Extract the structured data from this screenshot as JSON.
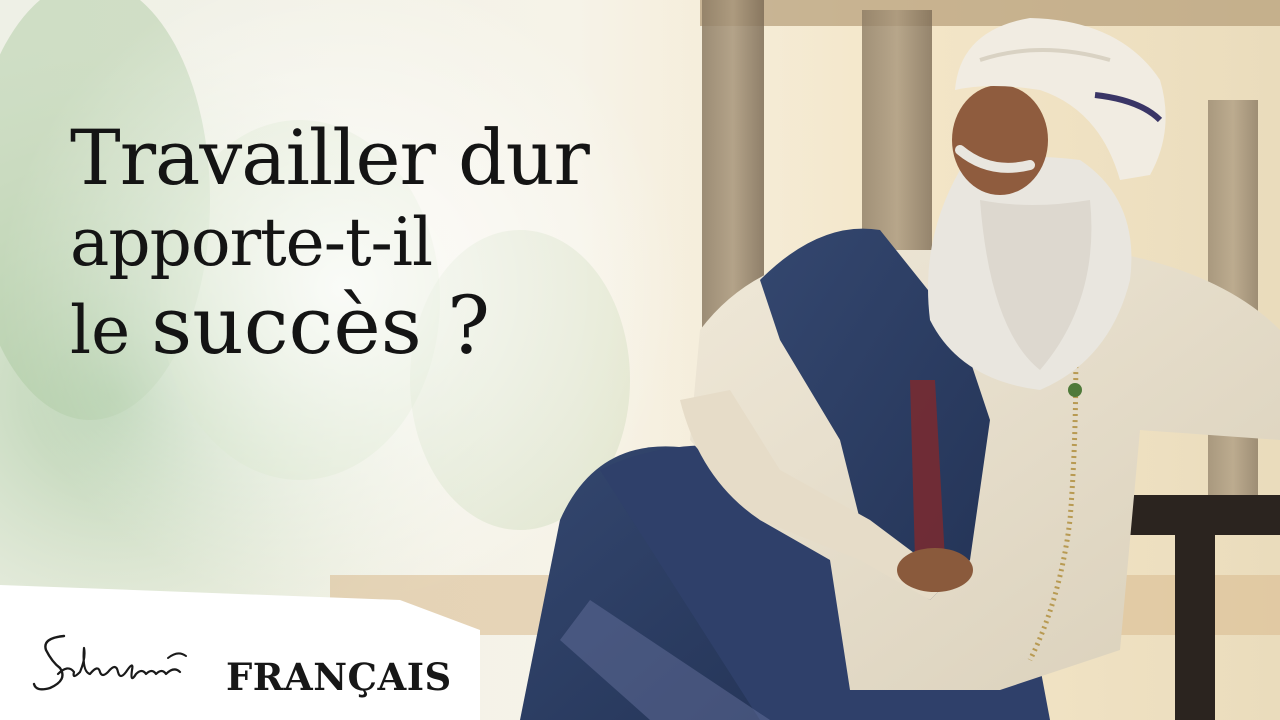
{
  "thumbnail": {
    "title_line_1": "Travailler dur",
    "title_line_2": "apporte-t-il",
    "title_line_3_small": "le",
    "title_line_3_big": "succès ?",
    "brand_signature": "Sadhguru",
    "language_label": "FRANÇAIS"
  },
  "colors": {
    "title_text": "#141414",
    "background_light": "#f3ead8",
    "shawl_blue": "#2d3e66",
    "kurta_cream": "#e9e1cf",
    "turban_white": "#f1ece2"
  }
}
